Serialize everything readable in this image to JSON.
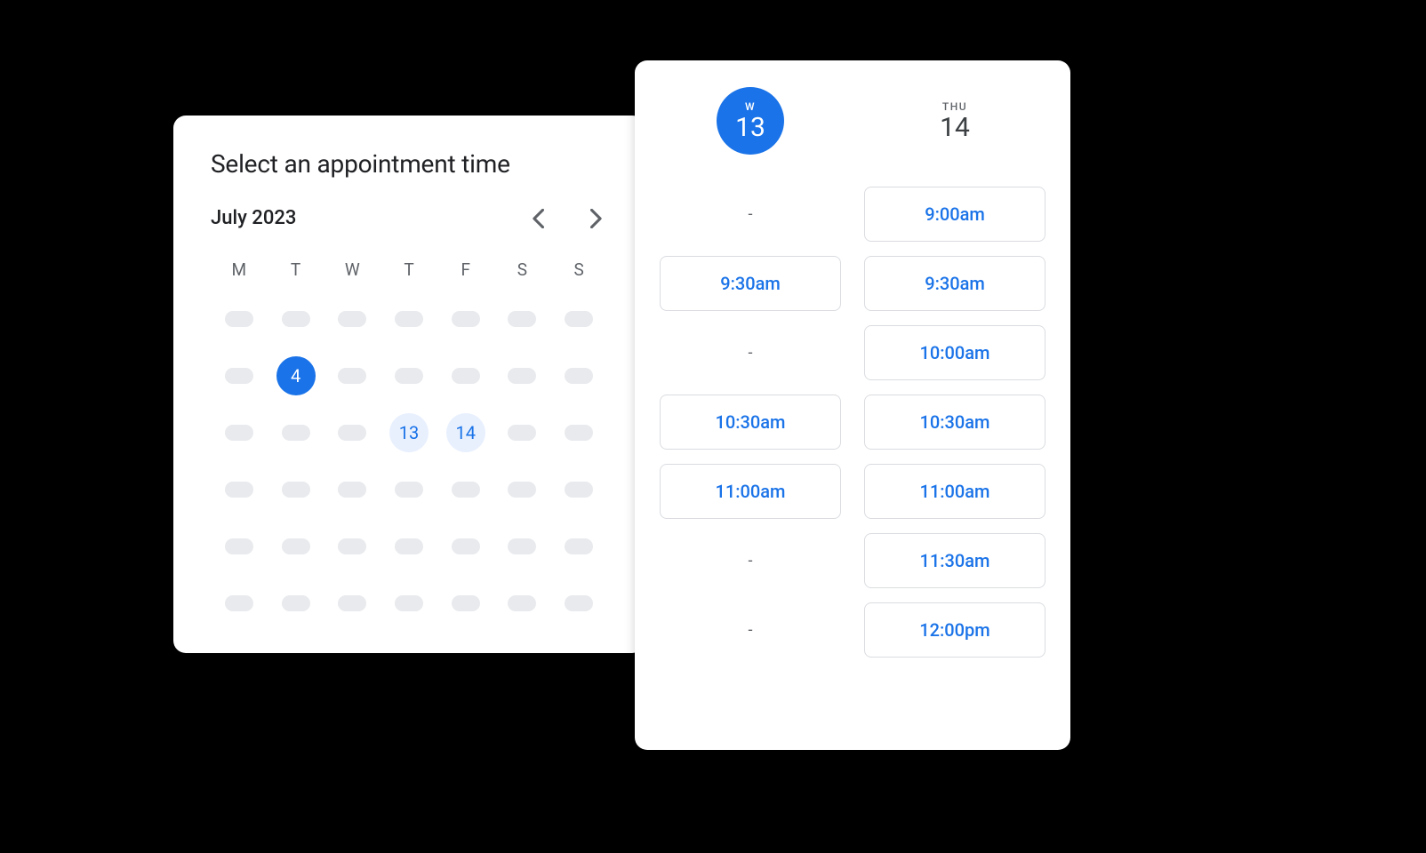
{
  "calendar": {
    "title": "Select an appointment time",
    "month": "July 2023",
    "weekdays": [
      "M",
      "T",
      "W",
      "T",
      "F",
      "S",
      "S"
    ],
    "days": [
      {
        "type": "pill"
      },
      {
        "type": "pill"
      },
      {
        "type": "pill"
      },
      {
        "type": "pill"
      },
      {
        "type": "pill"
      },
      {
        "type": "pill"
      },
      {
        "type": "pill"
      },
      {
        "type": "pill"
      },
      {
        "type": "selected",
        "label": "4"
      },
      {
        "type": "pill"
      },
      {
        "type": "pill"
      },
      {
        "type": "pill"
      },
      {
        "type": "pill"
      },
      {
        "type": "pill"
      },
      {
        "type": "pill"
      },
      {
        "type": "pill"
      },
      {
        "type": "pill"
      },
      {
        "type": "highlighted",
        "label": "13"
      },
      {
        "type": "highlighted",
        "label": "14"
      },
      {
        "type": "pill"
      },
      {
        "type": "pill"
      },
      {
        "type": "pill"
      },
      {
        "type": "pill"
      },
      {
        "type": "pill"
      },
      {
        "type": "pill"
      },
      {
        "type": "pill"
      },
      {
        "type": "pill"
      },
      {
        "type": "pill"
      },
      {
        "type": "pill"
      },
      {
        "type": "pill"
      },
      {
        "type": "pill"
      },
      {
        "type": "pill"
      },
      {
        "type": "pill"
      },
      {
        "type": "pill"
      },
      {
        "type": "pill"
      },
      {
        "type": "pill"
      },
      {
        "type": "pill"
      },
      {
        "type": "pill"
      },
      {
        "type": "pill"
      },
      {
        "type": "pill"
      },
      {
        "type": "pill"
      },
      {
        "type": "pill"
      }
    ]
  },
  "timeslots": {
    "columns": [
      {
        "abbr": "W",
        "num": "13",
        "selected": true,
        "slots": [
          {
            "type": "empty",
            "label": "-"
          },
          {
            "type": "available",
            "label": "9:30am"
          },
          {
            "type": "empty",
            "label": "-"
          },
          {
            "type": "available",
            "label": "10:30am"
          },
          {
            "type": "available",
            "label": "11:00am"
          },
          {
            "type": "empty",
            "label": "-"
          },
          {
            "type": "empty",
            "label": "-"
          }
        ]
      },
      {
        "abbr": "THU",
        "num": "14",
        "selected": false,
        "slots": [
          {
            "type": "available",
            "label": "9:00am"
          },
          {
            "type": "available",
            "label": "9:30am"
          },
          {
            "type": "available",
            "label": "10:00am"
          },
          {
            "type": "available",
            "label": "10:30am"
          },
          {
            "type": "available",
            "label": "11:00am"
          },
          {
            "type": "available",
            "label": "11:30am"
          },
          {
            "type": "available",
            "label": "12:00pm"
          }
        ]
      }
    ]
  },
  "colors": {
    "primary": "#1a73e8",
    "primaryLight": "#e8f0fe",
    "pillGray": "#e8eaed",
    "textPrimary": "#202124",
    "textSecondary": "#5f6368",
    "border": "#dadce0"
  }
}
